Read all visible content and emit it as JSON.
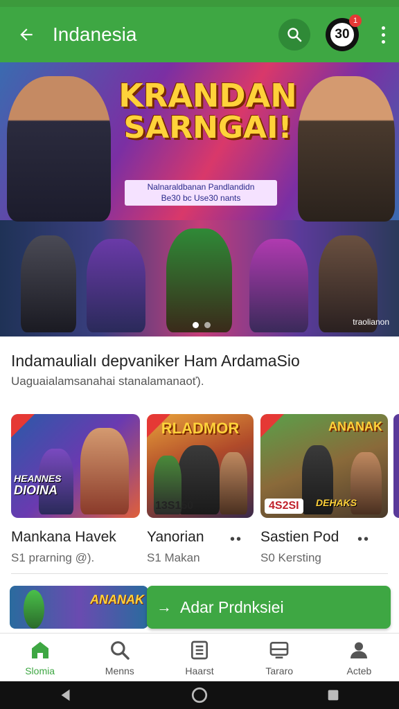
{
  "app_bar": {
    "title": "Indanesia",
    "badge_number": "30",
    "notification_count": "1"
  },
  "hero": {
    "title_line1": "KRANDAN",
    "title_line2": "SARNGAI!",
    "subtitle_line1": "Nalnaraldbanan Pandlandidn",
    "subtitle_line2": "Be30 bc Use30 nants",
    "caption": "traolianon",
    "carousel": {
      "total": 2,
      "active": 1
    }
  },
  "section": {
    "title": "Indamaulialı depvaniker Ham ArdamaSio",
    "subtitle": "Uaguaialamsanahai stanalamanaoť)."
  },
  "cards": [
    {
      "name": "Mankana Havek",
      "meta": "S1 prarning @).",
      "thumb_text": "DIOINA",
      "banner_text": "HEANNES",
      "has_more": false
    },
    {
      "name": "Yanorian",
      "meta": "S1 Makan",
      "thumb_text": "13S150",
      "banner_text": "RLADMOR",
      "has_more": true
    },
    {
      "name": "Sastien Pod",
      "meta": "S0 Kersting",
      "thumb_text": "4S2SI",
      "banner_text": "DEHAKS",
      "top_text": "ANANAK",
      "has_more": true
    }
  ],
  "more_label": "••",
  "promo": {
    "thumb_text": "ANANAK",
    "cta_label": "Adar  Prdnksiei"
  },
  "bottom_nav": [
    {
      "label": "Slomia",
      "icon": "home-icon",
      "active": true
    },
    {
      "label": "Menns",
      "icon": "search-icon",
      "active": false
    },
    {
      "label": "Haarst",
      "icon": "list-icon",
      "active": false
    },
    {
      "label": "Tararo",
      "icon": "tv-icon",
      "active": false
    },
    {
      "label": "Acteb",
      "icon": "person-icon",
      "active": false
    }
  ],
  "colors": {
    "primary": "#3ea743",
    "badge_red": "#e53935"
  }
}
